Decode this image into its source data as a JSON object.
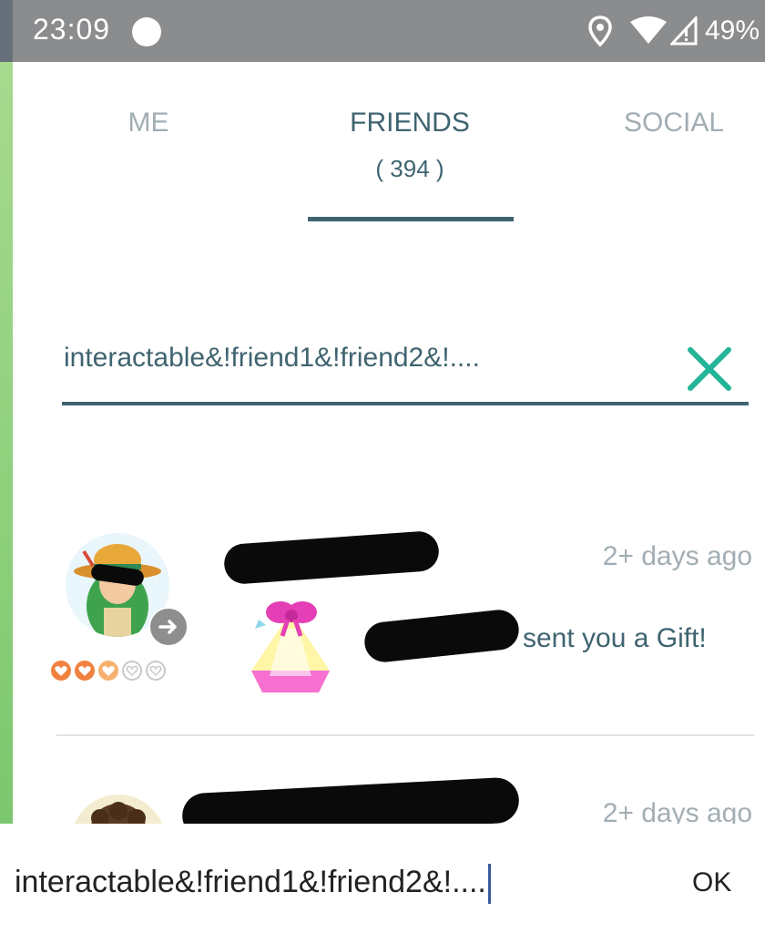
{
  "status_bar": {
    "time": "23:09",
    "battery": "49%",
    "icons": [
      "notification-dot-icon",
      "location-icon",
      "wifi-icon",
      "signal-icon"
    ]
  },
  "tabs": [
    {
      "label": "ME",
      "active": false
    },
    {
      "label": "FRIENDS",
      "count": "( 394 )",
      "active": true
    },
    {
      "label": "SOCIAL",
      "active": false
    }
  ],
  "search": {
    "value": "interactable&!friend1&!friend2&!...."
  },
  "friends": [
    {
      "timestamp": "2+ days ago",
      "message": "sent you a Gift!",
      "friendship_hearts": 2.5,
      "friendship_hearts_total": 5
    },
    {
      "timestamp": "2+ days ago"
    }
  ],
  "keyboard_bar": {
    "text": "interactable&!friend1&!friend2&!....",
    "ok_label": "OK"
  },
  "colors": {
    "accent": "#3f6470",
    "muted": "#a2aeb3",
    "clear_icon": "#23b59a",
    "status_bar": "#8b8c8e",
    "heart_orange": "#f0813f"
  }
}
